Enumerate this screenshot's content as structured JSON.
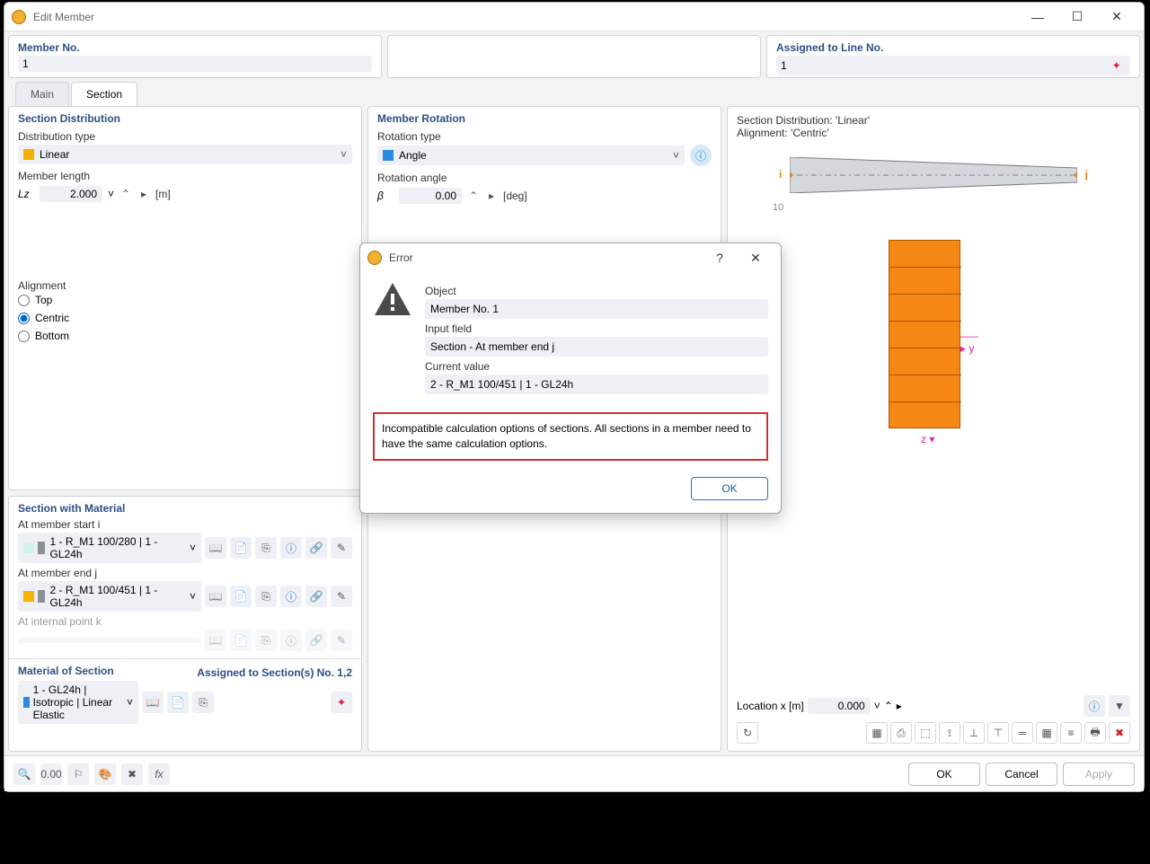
{
  "window": {
    "title": "Edit Member"
  },
  "header": {
    "memberNoLabel": "Member No.",
    "memberNoValue": "1",
    "assignedLabel": "Assigned to Line No.",
    "assignedValue": "1"
  },
  "tabs": {
    "main": "Main",
    "section": "Section"
  },
  "sectionDist": {
    "title": "Section Distribution",
    "distTypeLabel": "Distribution type",
    "distTypeValue": "Linear",
    "memberLenLabel": "Member length",
    "lzLabel": "Lz",
    "lzValue": "2.000",
    "lzUnit": "[m]",
    "alignmentLabel": "Alignment",
    "top": "Top",
    "centric": "Centric",
    "bottom": "Bottom"
  },
  "rotation": {
    "title": "Member Rotation",
    "typeLabel": "Rotation type",
    "typeValue": "Angle",
    "angleLabel": "Rotation angle",
    "betaLabel": "β",
    "betaValue": "0.00",
    "betaUnit": "[deg]"
  },
  "sectionMat": {
    "title": "Section with Material",
    "startLabel": "At member start i",
    "startValue": "1 - R_M1 100/280 | 1 - GL24h",
    "endLabel": "At member end j",
    "endValue": "2 - R_M1 100/451 | 1 - GL24h",
    "internalLabel": "At internal point k"
  },
  "material": {
    "title": "Material of Section",
    "assignedLabel": "Assigned to Section(s) No. 1,2",
    "value": "1 - GL24h | Isotropic | Linear Elastic"
  },
  "preview": {
    "line1": "Section Distribution: 'Linear'",
    "line2": "Alignment: 'Centric'",
    "i": "i",
    "j": "j",
    "y": "y",
    "z": "z",
    "locLabel": "Location x [m]",
    "locValue": "0.000",
    "overlap": "10"
  },
  "error": {
    "title": "Error",
    "objectLabel": "Object",
    "objectValue": "Member No. 1",
    "inputLabel": "Input field",
    "inputValue": "Section - At member end j",
    "curLabel": "Current value",
    "curValue": "2 - R_M1 100/451 | 1 - GL24h",
    "message": "Incompatible calculation options of sections. All sections in a member need to have the same calculation options.",
    "ok": "OK"
  },
  "buttons": {
    "ok": "OK",
    "cancel": "Cancel",
    "apply": "Apply"
  },
  "icons": {
    "chev": "˅",
    "spin": "⌃",
    "play": "▸",
    "info": "ⓘ",
    "book": "📖",
    "newdoc": "📄",
    "copy": "⎘",
    "link": "🔗",
    "wand": "✎",
    "pick": "✦",
    "help": "?",
    "close": "✕",
    "min": "—",
    "max": "☐"
  }
}
